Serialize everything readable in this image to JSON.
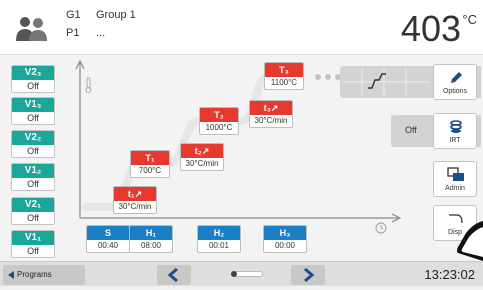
{
  "header": {
    "user_icon": "users-icon",
    "group_code": "G1",
    "group_name": "Group 1",
    "program_code": "P1",
    "program_name": "...",
    "temperature": "403",
    "temp_unit": "°C"
  },
  "vacuum": [
    {
      "label": "V2₃",
      "value": "Off"
    },
    {
      "label": "V1₃",
      "value": "Off"
    },
    {
      "label": "V2₂",
      "value": "Off"
    },
    {
      "label": "V1₂",
      "value": "Off"
    },
    {
      "label": "V2₁",
      "value": "Off"
    },
    {
      "label": "V1₁",
      "value": "Off"
    }
  ],
  "temps": [
    {
      "label": "T₁",
      "value": "700°C"
    },
    {
      "label": "T₂",
      "value": "1000°C"
    },
    {
      "label": "T₃",
      "value": "1100°C"
    }
  ],
  "rates": [
    {
      "label": "t₁↗",
      "value": "30°C/min"
    },
    {
      "label": "t₂↗",
      "value": "30°C/min"
    },
    {
      "label": "t₃↗",
      "value": "30°C/min"
    }
  ],
  "bottom": [
    {
      "label": "S",
      "value": "00:40"
    },
    {
      "label": "H₁",
      "value": "08:00"
    },
    {
      "label": "H₂",
      "value": "00:01"
    },
    {
      "label": "H₃",
      "value": "00:00"
    }
  ],
  "sidebar": {
    "options_label": "Options",
    "irt_state": "Off",
    "irt_label": "IRT",
    "admin_label": "Admin",
    "display_label": "Disp"
  },
  "footer": {
    "programs_label": "Programs",
    "time": "13:23:02"
  },
  "colors": {
    "teal": "#1aa79a",
    "red": "#e8392f",
    "blue": "#1b7fc6",
    "nav_blue": "#1b4f8a"
  }
}
